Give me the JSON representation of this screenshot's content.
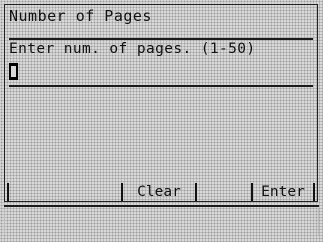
{
  "dialog": {
    "title": "Number of Pages",
    "prompt": "Enter num. of pages. (1-50)",
    "input_value": ""
  },
  "softkeys": {
    "clear_label": "Clear",
    "enter_label": "Enter"
  }
}
